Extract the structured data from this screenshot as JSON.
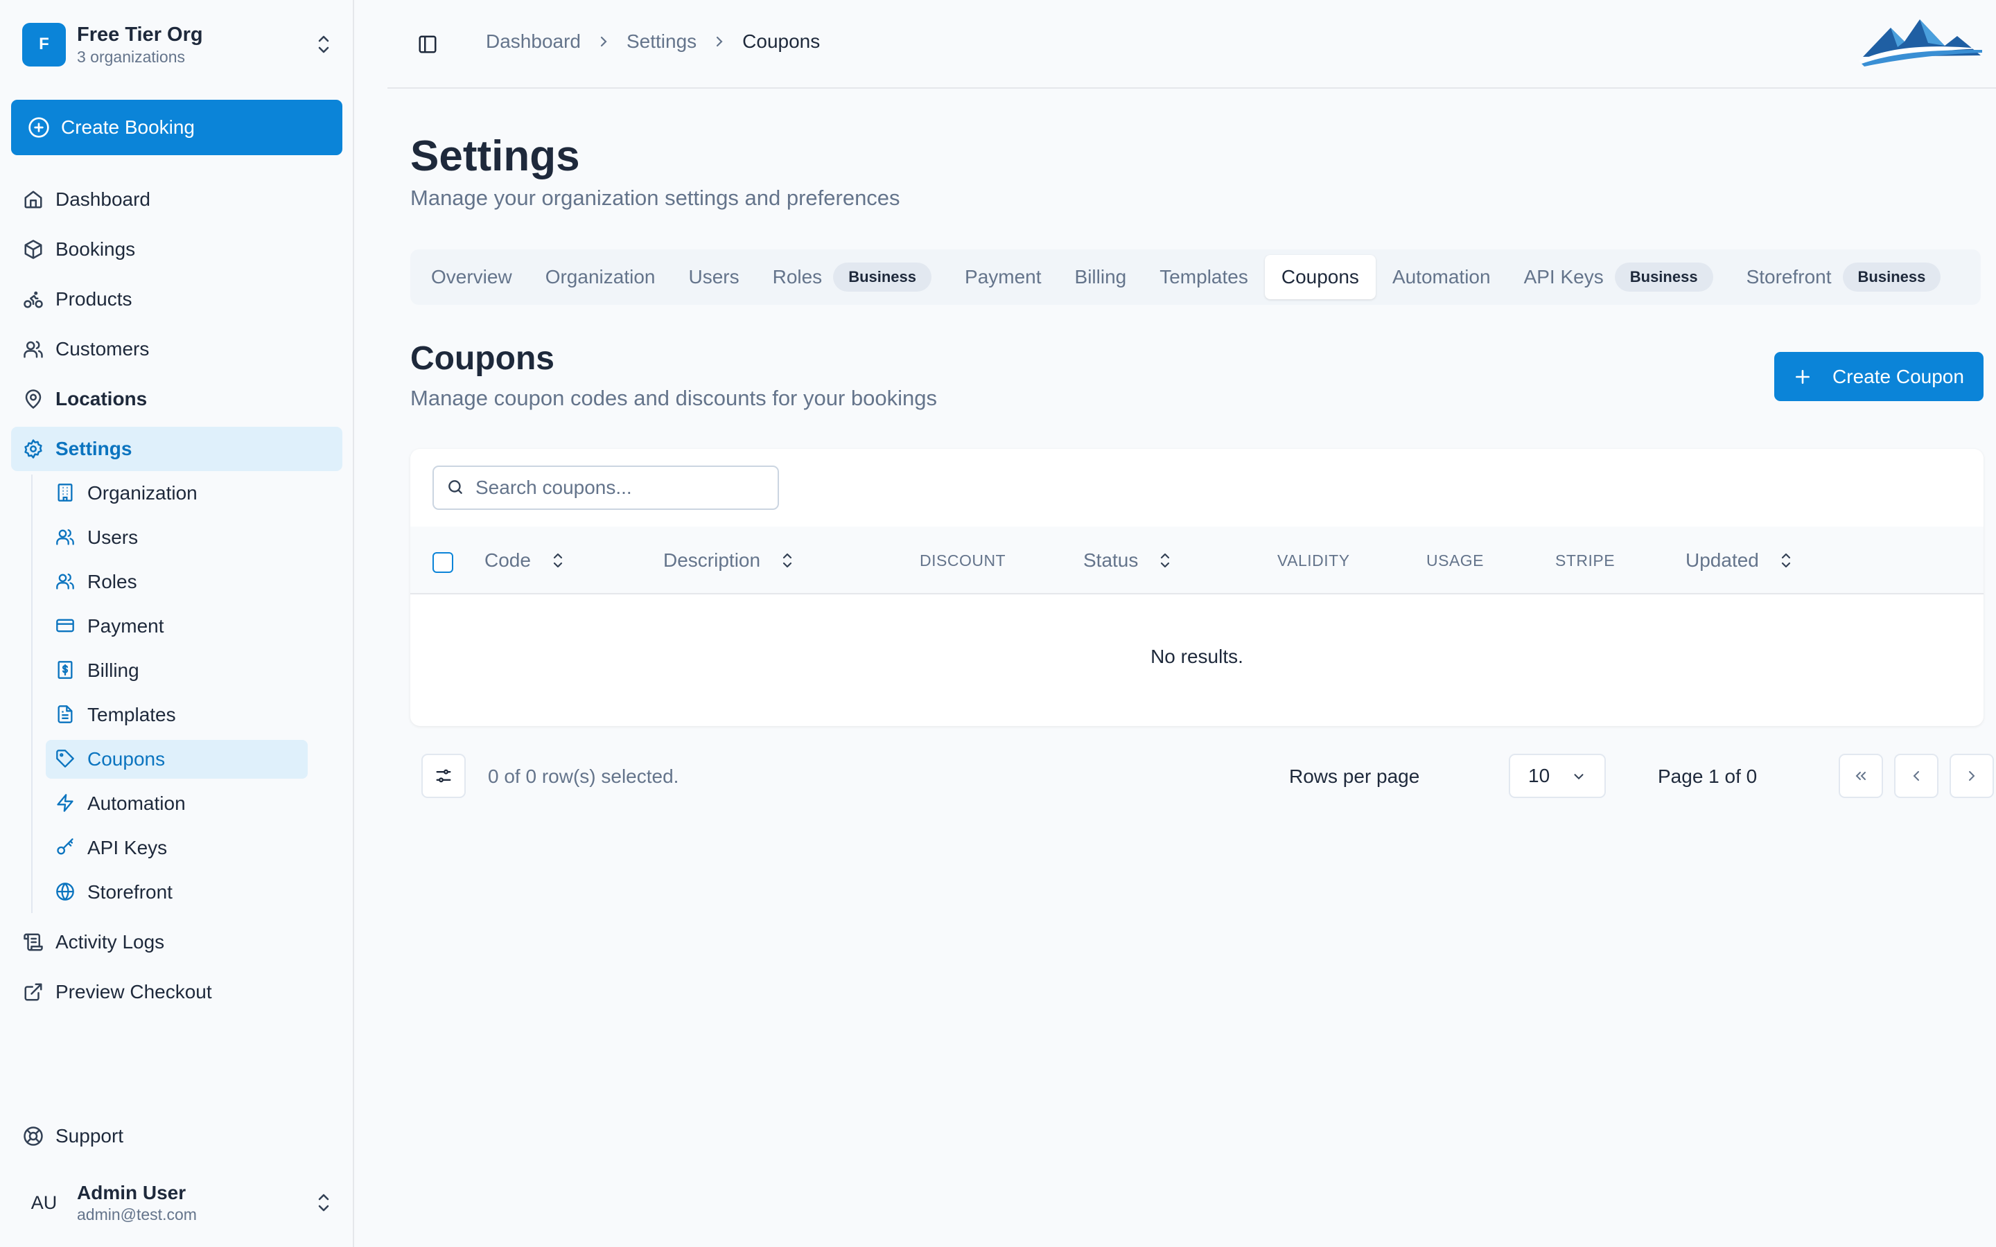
{
  "org": {
    "initial": "F",
    "name": "Free Tier Org",
    "subtitle": "3 organizations"
  },
  "sidebar": {
    "create_label": "Create Booking",
    "items": [
      {
        "label": "Dashboard",
        "icon": "home-icon"
      },
      {
        "label": "Bookings",
        "icon": "box-icon"
      },
      {
        "label": "Products",
        "icon": "bike-icon"
      },
      {
        "label": "Customers",
        "icon": "users-icon"
      },
      {
        "label": "Locations",
        "icon": "map-pin-icon"
      },
      {
        "label": "Settings",
        "icon": "gear-icon"
      }
    ],
    "settings_children": [
      {
        "label": "Organization",
        "icon": "building-icon"
      },
      {
        "label": "Users",
        "icon": "users-icon"
      },
      {
        "label": "Roles",
        "icon": "users-icon"
      },
      {
        "label": "Payment",
        "icon": "credit-card-icon"
      },
      {
        "label": "Billing",
        "icon": "receipt-icon"
      },
      {
        "label": "Templates",
        "icon": "file-text-icon"
      },
      {
        "label": "Coupons",
        "icon": "tag-icon"
      },
      {
        "label": "Automation",
        "icon": "zap-icon"
      },
      {
        "label": "API Keys",
        "icon": "key-icon"
      },
      {
        "label": "Storefront",
        "icon": "globe-icon"
      }
    ],
    "bottom_items": [
      {
        "label": "Activity Logs",
        "icon": "scroll-icon"
      },
      {
        "label": "Preview Checkout",
        "icon": "external-link-icon"
      }
    ],
    "support_label": "Support"
  },
  "user": {
    "initials": "AU",
    "name": "Admin User",
    "email": "admin@test.com"
  },
  "breadcrumb": [
    "Dashboard",
    "Settings",
    "Coupons"
  ],
  "page": {
    "title": "Settings",
    "subtitle": "Manage your organization settings and preferences"
  },
  "tabs": [
    {
      "label": "Overview"
    },
    {
      "label": "Organization"
    },
    {
      "label": "Users"
    },
    {
      "label": "Roles",
      "badge": "Business"
    },
    {
      "label": "Payment"
    },
    {
      "label": "Billing"
    },
    {
      "label": "Templates"
    },
    {
      "label": "Coupons",
      "active": true
    },
    {
      "label": "Automation"
    },
    {
      "label": "API Keys",
      "badge": "Business"
    },
    {
      "label": "Storefront",
      "badge": "Business"
    }
  ],
  "coupons": {
    "title": "Coupons",
    "subtitle": "Manage coupon codes and discounts for your bookings",
    "create_label": "Create Coupon",
    "search_placeholder": "Search coupons...",
    "columns": [
      "Code",
      "Description",
      "DISCOUNT",
      "Status",
      "VALIDITY",
      "USAGE",
      "STRIPE",
      "Updated"
    ],
    "empty_text": "No results."
  },
  "footer": {
    "selected_text": "0 of 0 row(s) selected.",
    "rows_label": "Rows per page",
    "rows_value": "10",
    "page_text": "Page 1 of 0"
  },
  "colors": {
    "accent": "#0b84d8",
    "active_bg": "#dff0fb",
    "active_text": "#0b74bf"
  }
}
